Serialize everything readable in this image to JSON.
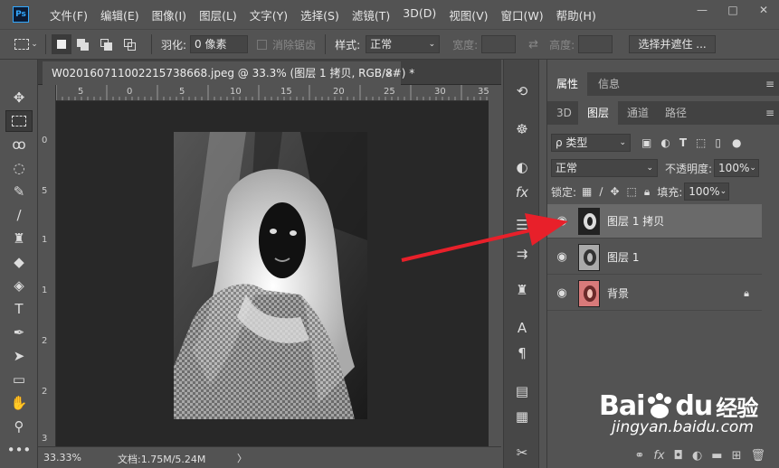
{
  "menubar": {
    "logo": "Ps",
    "items": [
      "文件(F)",
      "编辑(E)",
      "图像(I)",
      "图层(L)",
      "文字(Y)",
      "选择(S)",
      "滤镜(T)",
      "3D(D)",
      "视图(V)",
      "窗口(W)",
      "帮助(H)"
    ],
    "min_icon": "—",
    "max_icon": "□",
    "close_icon": "✕"
  },
  "options": {
    "feather_label": "羽化:",
    "feather_value": "0 像素",
    "antialias_label": "消除锯齿",
    "style_label": "样式:",
    "style_value": "正常",
    "width_label": "宽度:",
    "height_label": "高度:",
    "select_mask_button": "选择并遮住 ..."
  },
  "document": {
    "tab_title": "W020160711002215738668.jpeg @ 33.3% (图层 1 拷贝, RGB/8#) *",
    "close_icon": "×",
    "ruler_h": [
      "5",
      "0",
      "5",
      "10",
      "15",
      "20",
      "25",
      "30",
      "35"
    ],
    "ruler_v": [
      "0",
      "5",
      "1",
      "1",
      "2",
      "2",
      "3"
    ],
    "zoom": "33.33%",
    "doc_info": "文档:1.75M/5.24M",
    "status_arrow": "〉"
  },
  "panels": {
    "tab_properties": "属性",
    "tab_info": "信息",
    "tab_3d": "3D",
    "tab_layers": "图层",
    "tab_channels": "通道",
    "tab_paths": "路径",
    "filter_kind": "ρ 类型",
    "blend_mode": "正常",
    "opacity_label": "不透明度:",
    "opacity_value": "100%",
    "lock_label": "锁定:",
    "fill_label": "填充:",
    "fill_value": "100%",
    "layers": [
      {
        "name": "图层 1 拷贝",
        "selected": true
      },
      {
        "name": "图层 1",
        "selected": false
      },
      {
        "name": "背景",
        "selected": false
      }
    ]
  },
  "watermark": {
    "brand": "Bai",
    "brand2": "du",
    "cn": "经验",
    "url": "jingyan.baidu.com"
  },
  "colors": {
    "accent": "#31a8ff",
    "arrow": "#e8202a"
  }
}
